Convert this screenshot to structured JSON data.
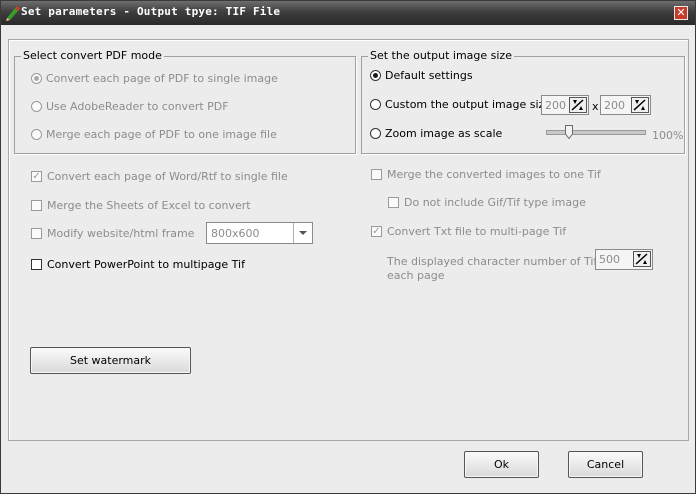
{
  "window": {
    "title": "Set parameters - Output tpye: TIF File",
    "close_glyph": "✕"
  },
  "pdf_mode": {
    "title": "Select convert PDF mode",
    "options": [
      {
        "label": "Convert each page of PDF to single image",
        "selected": true
      },
      {
        "label": "Use AdobeReader to convert PDF",
        "selected": false
      },
      {
        "label": "Merge each page of PDF to one image file",
        "selected": false
      }
    ]
  },
  "output_size": {
    "title": "Set the output image size",
    "default_label": "Default settings",
    "custom_label": "Custom the output image size",
    "width_value": "200",
    "x_sep": "x",
    "height_value": "200",
    "zoom_label": "Zoom image as scale",
    "zoom_value": "100%",
    "zoom_level": 0.23,
    "selected": "default"
  },
  "options_left": {
    "word_label": "Convert each page of Word/Rtf to single file",
    "word_checked": true,
    "excel_label": "Merge the Sheets of Excel to convert",
    "excel_checked": false,
    "frame_label": "Modify website/html frame",
    "frame_checked": false,
    "frame_value": "800x600",
    "ppt_label": "Convert PowerPoint to multipage Tif",
    "ppt_checked": false
  },
  "options_right": {
    "merge_label": "Merge the converted images to one Tif",
    "merge_checked": false,
    "gif_label": "Do not include Gif/Tif type image",
    "gif_checked": false,
    "txt_label": "Convert Txt file to multi-page Tif",
    "txt_checked": true,
    "chars_label_line1": "The displayed character number of Tif",
    "chars_label_line2": "each page",
    "chars_value": "500"
  },
  "buttons": {
    "watermark": "Set watermark",
    "ok": "Ok",
    "cancel": "Cancel"
  },
  "icons": {
    "app": "pencil-icon",
    "spin": "spin-arrows-icon",
    "dropdown": "chevron-down-icon"
  },
  "colors": {
    "title_bar": "#3e3e3e",
    "dialog_bg": "#ececec",
    "close_button": "#c83a2a",
    "disabled_text": "#8c8c8c"
  }
}
